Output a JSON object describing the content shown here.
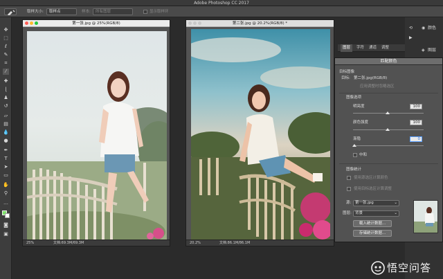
{
  "app": {
    "window_title": "Adobe Photoshop CC 2017"
  },
  "options_bar": {
    "sample_size_label": "取样大小:",
    "sample_size_value": "取样点",
    "sample_label": "样本:",
    "sample_value": "所有图层",
    "show_ring_label": "显示取样环"
  },
  "toolbar": {
    "tools": [
      "move-tool",
      "marquee-tool",
      "lasso-tool",
      "quick-select-tool",
      "crop-tool",
      "eyedropper-tool",
      "healing-tool",
      "brush-tool",
      "clone-stamp-tool",
      "history-brush-tool",
      "eraser-tool",
      "gradient-tool",
      "blur-tool",
      "dodge-tool",
      "pen-tool",
      "type-tool",
      "path-select-tool",
      "shape-tool",
      "hand-tool",
      "zoom-tool"
    ],
    "fg_color": "#7fe36b",
    "bg_color": "#ffffff"
  },
  "doc1": {
    "tab_title": "第一张.jpg @ 25%(RGB/8)",
    "zoom": "25%",
    "doc_size": "文档:69.3M/69.3M"
  },
  "doc2": {
    "tab_title": "第二张.jpg @ 20.2%(RGB/8) *",
    "zoom": "20.2%",
    "doc_size": "文档:86.1M/86.1M"
  },
  "panels": {
    "tabs": [
      "图层",
      "字符",
      "通道",
      "调整"
    ],
    "right_labels": [
      "颜色",
      "图层"
    ]
  },
  "match_color": {
    "title": "匹配颜色",
    "target_section": "目标图像",
    "target_label": "目标:",
    "target_value": "第二张.jpg(RGB/8)",
    "apply_adjust_label": "应用调整时忽略选区",
    "image_options_label": "图像选项",
    "luminance_label": "明亮度",
    "luminance_value": "100",
    "color_intensity_label": "颜色强度",
    "color_intensity_value": "100",
    "fade_label": "渐隐",
    "fade_value": "0",
    "neutralize_label": "中和",
    "image_stats_label": "图像统计",
    "use_source_sel_label": "使用源选区计算颜色",
    "use_target_sel_label": "使用目标选区计算调整",
    "source_label": "源:",
    "source_value": "第一张.jpg",
    "layer_label": "图层:",
    "layer_value": "背景",
    "load_stats_button": "载入统计数据...",
    "save_stats_button": "存储统计数据..."
  },
  "watermark": {
    "text": "悟空问答"
  }
}
